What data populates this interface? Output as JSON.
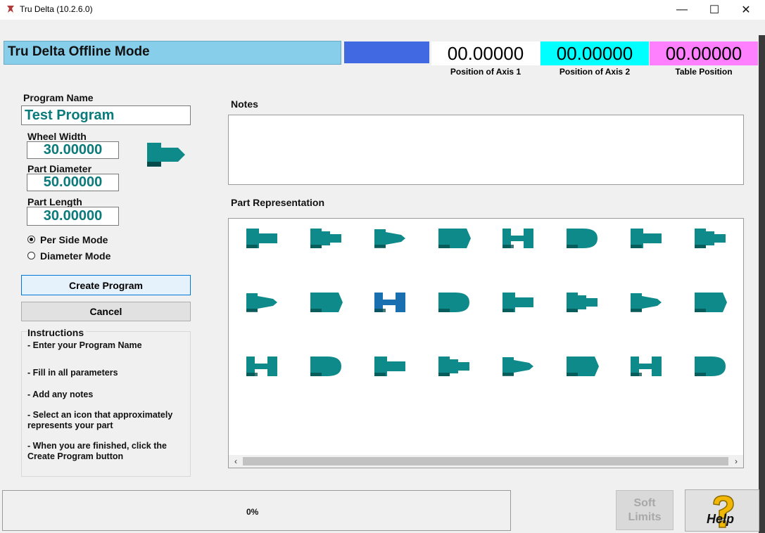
{
  "window": {
    "title": "Tru Delta (10.2.6.0)",
    "min": "—",
    "max": "☐",
    "close": "✕"
  },
  "header": {
    "mode": "Tru Delta Offline Mode",
    "axes": [
      {
        "value": "00.00000",
        "label": "Position of Axis 1",
        "color": "#ffffff"
      },
      {
        "value": "00.00000",
        "label": "Position of Axis 2",
        "color": "#00ffff"
      },
      {
        "value": "00.00000",
        "label": "Table Position",
        "color": "#ff80ff"
      }
    ]
  },
  "form": {
    "program_name_label": "Program Name",
    "program_name": "Test Program",
    "wheel_width_label": "Wheel Width",
    "wheel_width": "30.00000",
    "part_diameter_label": "Part Diameter",
    "part_diameter": "50.00000",
    "part_length_label": "Part Length",
    "part_length": "30.00000",
    "mode_options": [
      "Per Side Mode",
      "Diameter Mode"
    ],
    "selected_mode": "Per Side Mode",
    "create_label": "Create Program",
    "cancel_label": "Cancel"
  },
  "instructions": {
    "title": "Instructions",
    "items": [
      "- Enter your Program Name",
      "- Fill in all parameters",
      "- Add any notes",
      "- Select an icon that approximately represents your part",
      "- When you are finished, click the Create Program button"
    ]
  },
  "notes": {
    "label": "Notes",
    "value": ""
  },
  "part_representation": {
    "label": "Part Representation",
    "icon_color": "#0e8a8a",
    "selected_color": "#1a6fb0",
    "selected_index": 10,
    "icons": [
      "shaft-step-icon",
      "shaft-multistep-icon",
      "shaft-taper-step-icon",
      "shaft-taper-icon",
      "shaft-neck-icon",
      "shaft-pointed-icon",
      "shaft-groove-icon",
      "shaft-flare-icon",
      "shaft-concave-icon",
      "shaft-double-taper-icon",
      "shaft-pointed-small-icon",
      "shaft-cone-step-icon",
      "shaft-spool-icon",
      "shaft-cone-icon",
      "shaft-collar-icon",
      "shaft-round-end-icon",
      "shaft-round-head-icon",
      "shaft-round-pin-icon",
      "shaft-cone-pin-icon",
      "shaft-tapered-pin-icon",
      "shaft-shoulder-icon",
      "shaft-shoulder-step-icon",
      "shaft-shoulder-pin-icon",
      "shaft-plain-step-icon"
    ]
  },
  "status": {
    "progress_text": "0%",
    "progress": 0
  },
  "buttons": {
    "soft_limits": "Soft Limits",
    "help": "Help"
  }
}
